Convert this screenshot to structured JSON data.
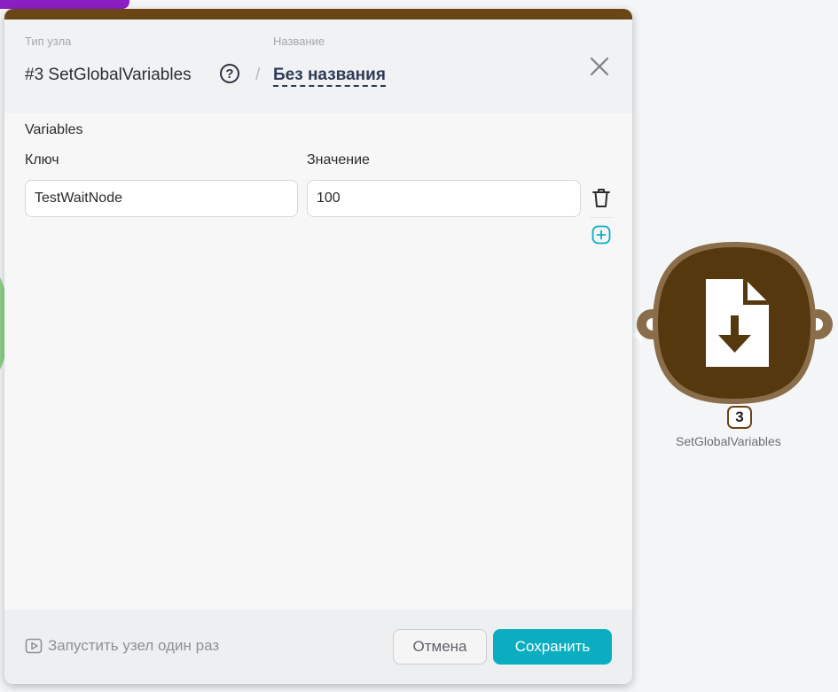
{
  "header": {
    "type_label": "Тип узла",
    "type_value": "#3 SetGlobalVariables",
    "help_glyph": "?",
    "separator": "/",
    "name_label": "Название",
    "name_value": "Без названия"
  },
  "body": {
    "section_title": "Variables",
    "key_label": "Ключ",
    "value_label": "Значение",
    "rows": [
      {
        "key": "TestWaitNode",
        "value": "100"
      }
    ]
  },
  "footer": {
    "run_once_label": "Запустить узел один раз",
    "cancel_label": "Отмена",
    "save_label": "Сохранить"
  },
  "node": {
    "badge": "3",
    "label": "SetGlobalVariables",
    "icon": "file-download-icon"
  },
  "colors": {
    "accent": "#0aaec0",
    "node_brown": "#56380f",
    "node_border": "#8a6d4a",
    "top_bar": "#6b4515"
  }
}
